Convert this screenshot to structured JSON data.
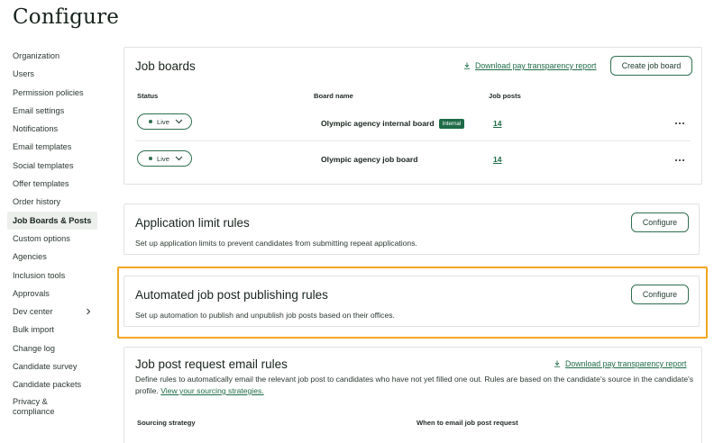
{
  "page": {
    "title": "Configure"
  },
  "sidebar": {
    "items": [
      {
        "label": "Organization"
      },
      {
        "label": "Users"
      },
      {
        "label": "Permission policies"
      },
      {
        "label": "Email settings"
      },
      {
        "label": "Notifications"
      },
      {
        "label": "Email templates"
      },
      {
        "label": "Social templates"
      },
      {
        "label": "Offer templates"
      },
      {
        "label": "Order history"
      },
      {
        "label": "Job Boards & Posts",
        "active": true
      },
      {
        "label": "Custom options"
      },
      {
        "label": "Agencies"
      },
      {
        "label": "Inclusion tools"
      },
      {
        "label": "Approvals"
      },
      {
        "label": "Dev center",
        "has_chevron": true
      },
      {
        "label": "Bulk import"
      },
      {
        "label": "Change log"
      },
      {
        "label": "Candidate survey"
      },
      {
        "label": "Candidate packets"
      },
      {
        "label": "Privacy & compliance"
      }
    ]
  },
  "job_boards": {
    "title": "Job boards",
    "download_link": "Download pay transparency report",
    "create_button": "Create job board",
    "columns": {
      "status": "Status",
      "board_name": "Board name",
      "job_posts": "Job posts"
    },
    "rows": [
      {
        "status": "Live",
        "name": "Olympic agency internal board",
        "badge": "Internal",
        "posts": "14"
      },
      {
        "status": "Live",
        "name": "Olympic agency job board",
        "badge": "",
        "posts": "14"
      }
    ]
  },
  "application_limit": {
    "title": "Application limit rules",
    "description": "Set up application limits to prevent candidates from submitting repeat applications.",
    "button": "Configure"
  },
  "automated_publishing": {
    "title": "Automated job post publishing rules",
    "description": "Set up automation to publish and unpublish job posts based on their offices.",
    "button": "Configure"
  },
  "request_email": {
    "title": "Job post request email rules",
    "download_link": "Download pay transparency report",
    "description": "Define rules to automatically email the relevant job post to candidates who have not yet filled one out. Rules are based on the candidate's source in the candidate's profile.",
    "link": "View your sourcing strategies.",
    "columns": {
      "strategy": "Sourcing strategy",
      "when": "When to email job post request"
    }
  },
  "colors": {
    "brand_green": "#1f6b47",
    "highlight": "#f5a623"
  },
  "icons": {
    "download": "download-icon",
    "more": "more-horizontal-icon",
    "chevron": "chevron-down-icon"
  }
}
